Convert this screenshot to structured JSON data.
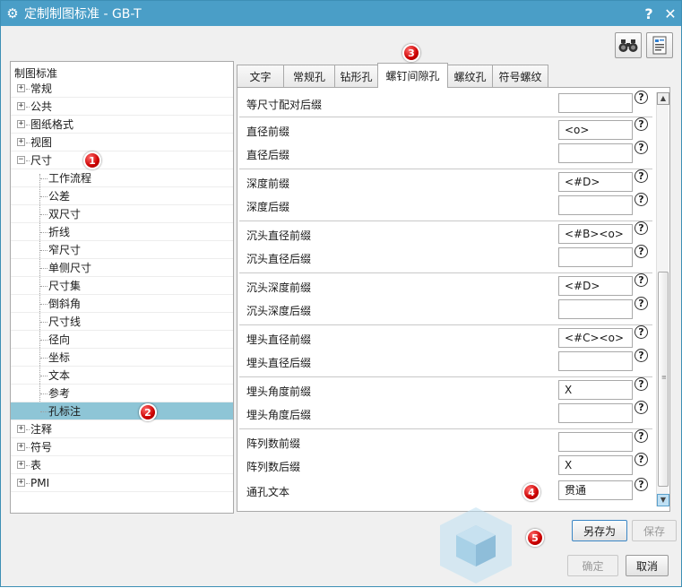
{
  "window": {
    "title": "定制制图标准 - GB-T",
    "help_label": "?",
    "close_label": "✕"
  },
  "toolbar": {
    "find_icon": "binoculars-icon",
    "report_icon": "document-report-icon"
  },
  "tree": {
    "root_label": "制图标准",
    "items": [
      {
        "label": "常规",
        "level": 0,
        "expander": "+"
      },
      {
        "label": "公共",
        "level": 0,
        "expander": "+"
      },
      {
        "label": "图纸格式",
        "level": 0,
        "expander": "+"
      },
      {
        "label": "视图",
        "level": 0,
        "expander": "+"
      },
      {
        "label": "尺寸",
        "level": 0,
        "expander": "−"
      },
      {
        "label": "工作流程",
        "level": 1
      },
      {
        "label": "公差",
        "level": 1
      },
      {
        "label": "双尺寸",
        "level": 1
      },
      {
        "label": "折线",
        "level": 1
      },
      {
        "label": "窄尺寸",
        "level": 1
      },
      {
        "label": "单侧尺寸",
        "level": 1
      },
      {
        "label": "尺寸集",
        "level": 1
      },
      {
        "label": "倒斜角",
        "level": 1
      },
      {
        "label": "尺寸线",
        "level": 1
      },
      {
        "label": "径向",
        "level": 1
      },
      {
        "label": "坐标",
        "level": 1
      },
      {
        "label": "文本",
        "level": 1
      },
      {
        "label": "参考",
        "level": 1
      },
      {
        "label": "孔标注",
        "level": 1,
        "selected": true
      },
      {
        "label": "注释",
        "level": 0,
        "expander": "+"
      },
      {
        "label": "符号",
        "level": 0,
        "expander": "+"
      },
      {
        "label": "表",
        "level": 0,
        "expander": "+"
      },
      {
        "label": "PMI",
        "level": 0,
        "expander": "+"
      }
    ]
  },
  "tabs": [
    {
      "label": "文字"
    },
    {
      "label": "常规孔"
    },
    {
      "label": "钻形孔"
    },
    {
      "label": "螺钉间隙孔",
      "active": true
    },
    {
      "label": "螺纹孔"
    },
    {
      "label": "符号螺纹"
    }
  ],
  "fields": [
    {
      "label": "等尺寸配对后缀",
      "value": ""
    },
    {
      "label": "直径前缀",
      "value": "<o>"
    },
    {
      "label": "直径后缀",
      "value": ""
    },
    {
      "label": "深度前缀",
      "value": "<#D>"
    },
    {
      "label": "深度后缀",
      "value": ""
    },
    {
      "label": "沉头直径前缀",
      "value": "<#B><o>"
    },
    {
      "label": "沉头直径后缀",
      "value": ""
    },
    {
      "label": "沉头深度前缀",
      "value": "<#D>"
    },
    {
      "label": "沉头深度后缀",
      "value": ""
    },
    {
      "label": "埋头直径前缀",
      "value": "<#C><o>"
    },
    {
      "label": "埋头直径后缀",
      "value": ""
    },
    {
      "label": "埋头角度前缀",
      "value": "X"
    },
    {
      "label": "埋头角度后缀",
      "value": ""
    },
    {
      "label": "阵列数前缀",
      "value": ""
    },
    {
      "label": "阵列数后缀",
      "value": "X"
    },
    {
      "label": "通孔文本",
      "value": "贯通"
    }
  ],
  "help_glyph": "?",
  "buttons": {
    "save_as": "另存为",
    "save": "保存",
    "ok": "确定",
    "cancel": "取消"
  },
  "markers": [
    "1",
    "2",
    "3",
    "4",
    "5"
  ],
  "colors": {
    "titlebar": "#4a9ec7",
    "selection": "#8ec5d6",
    "marker": "#cc0000"
  }
}
